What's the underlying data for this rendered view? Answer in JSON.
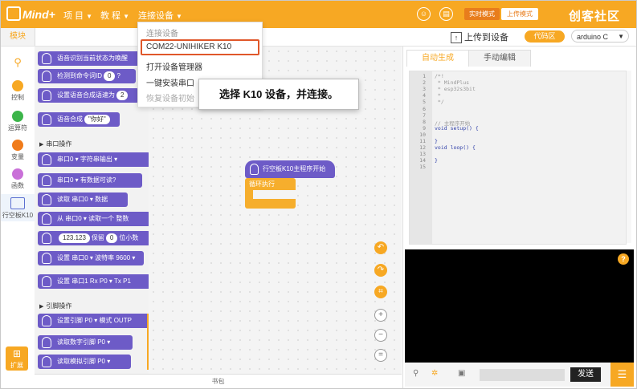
{
  "app": {
    "logo": "Mind+"
  },
  "topbar": {
    "menus": [
      {
        "label": "项 目"
      },
      {
        "label": "教 程"
      },
      {
        "label": "连接设备"
      }
    ],
    "mode_realtime": "实时模式",
    "mode_upload": "上传模式",
    "watermark": "创客社区",
    "colors": {
      "accent": "#f7a823",
      "block_purple": "#6d5bc7",
      "block_orange": "#f6ae2d",
      "highlight": "#e0572a"
    }
  },
  "toolbar": {
    "modules_tab": "模块",
    "upload_label": "上传到设备",
    "code_btn": "代码区",
    "board": "arduino C"
  },
  "categories": [
    {
      "label": "",
      "icon": "search-icon"
    },
    {
      "label": "控制",
      "color": "#f7a823"
    },
    {
      "label": "运算符",
      "color": "#3cb54a"
    },
    {
      "label": "变量",
      "color": "#f07b1a"
    },
    {
      "label": "函数",
      "color": "#c970d8"
    },
    {
      "label": "行空板K10",
      "icon": "board-icon"
    }
  ],
  "extension_label": "扩展",
  "palette": {
    "blocks": [
      {
        "text": "语音识别当前状态为唤醒",
        "color": "#6d5bc7"
      },
      {
        "text": "检测到命令词ID",
        "pill": "0",
        "suffix": "?",
        "color": "#6d5bc7"
      },
      {
        "text": "设置语音合成语速为",
        "pill": "2",
        "color": "#6d5bc7"
      },
      {
        "text": "语音合成",
        "pill": "\"你好\"",
        "color": "#6d5bc7"
      },
      {
        "text": "串口0 ▾  字符串输出 ▾",
        "color": "#6d5bc7"
      },
      {
        "text": "串口0 ▾  有数据可读?",
        "color": "#6d5bc7"
      },
      {
        "text": "读取  串口0 ▾  数据",
        "color": "#6d5bc7"
      },
      {
        "text": "从  串口0 ▾  读取一个  整数",
        "color": "#6d5bc7"
      },
      {
        "text": "保留",
        "pill": "123.123",
        "suffix": "位小数",
        "pill2": "0",
        "color": "#6d5bc7"
      },
      {
        "text": "设置 串口0 ▾ 波特率   9600 ▾",
        "color": "#6d5bc7"
      },
      {
        "text": "设置 串口1 Rx   P0 ▾   Tx   P1",
        "color": "#6d5bc7"
      },
      {
        "text": "设置引脚   P0 ▾   模式   OUTP",
        "color": "#6d5bc7"
      },
      {
        "text": "读取数字引脚   P0 ▾",
        "color": "#6d5bc7"
      },
      {
        "text": "读取模拟引脚   P0 ▾",
        "color": "#6d5bc7"
      }
    ],
    "sections": {
      "serial": "串口操作",
      "pins": "引脚操作"
    }
  },
  "workspace": {
    "main_block": "行空板K10主程序开始",
    "loop_block": "循环执行",
    "status": "书包"
  },
  "dropdown": {
    "header": "连接设备",
    "items": [
      {
        "label": "COM22-UNIHIKER K10",
        "selected": true
      },
      {
        "label": "打开设备管理器"
      },
      {
        "label": "一键安装串口"
      },
      {
        "label": "恢复设备初始"
      }
    ]
  },
  "callout": {
    "text": "选择 K10 设备，并连接。"
  },
  "right_panel": {
    "tab_auto": "自动生成",
    "tab_manual": "手动编辑",
    "code_lines": [
      {
        "n": "1",
        "t": "/*!",
        "cls": "cmt"
      },
      {
        "n": "2",
        "t": " * MindPlus",
        "cls": "cmt"
      },
      {
        "n": "3",
        "t": " * esp32s3bit",
        "cls": "cmt"
      },
      {
        "n": "4",
        "t": " *",
        "cls": "cmt"
      },
      {
        "n": "5",
        "t": " */",
        "cls": "cmt"
      },
      {
        "n": "6",
        "t": "",
        "cls": ""
      },
      {
        "n": "7",
        "t": "",
        "cls": ""
      },
      {
        "n": "8",
        "t": "// 主程序开始",
        "cls": "cmt"
      },
      {
        "n": "9",
        "t": "void setup() {",
        "cls": "kw"
      },
      {
        "n": "10",
        "t": "",
        "cls": ""
      },
      {
        "n": "11",
        "t": "}",
        "cls": "kw"
      },
      {
        "n": "12",
        "t": "void loop() {",
        "cls": "kw"
      },
      {
        "n": "13",
        "t": "",
        "cls": ""
      },
      {
        "n": "14",
        "t": "}",
        "cls": "kw"
      },
      {
        "n": "15",
        "t": "",
        "cls": ""
      }
    ],
    "send_label": "发送"
  }
}
